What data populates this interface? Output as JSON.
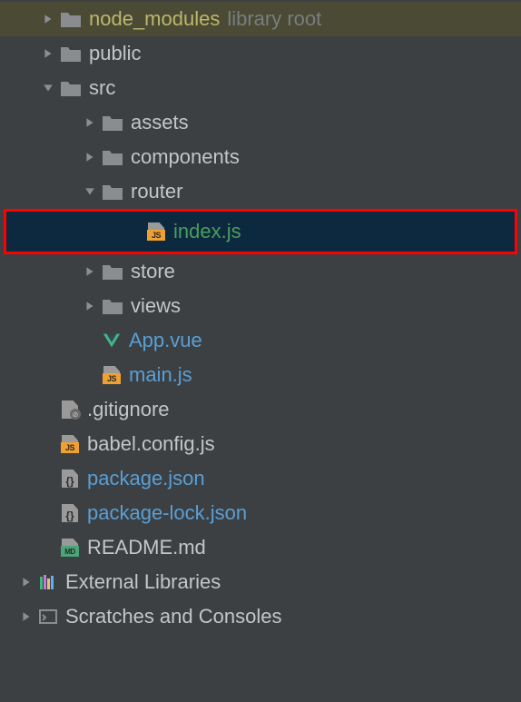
{
  "tree": {
    "node_modules": {
      "label": "node_modules",
      "hint": "library root"
    },
    "public": {
      "label": "public"
    },
    "src": {
      "label": "src"
    },
    "assets": {
      "label": "assets"
    },
    "components": {
      "label": "components"
    },
    "router": {
      "label": "router"
    },
    "index_js": {
      "label": "index.js"
    },
    "store": {
      "label": "store"
    },
    "views": {
      "label": "views"
    },
    "app_vue": {
      "label": "App.vue"
    },
    "main_js": {
      "label": "main.js"
    },
    "gitignore": {
      "label": ".gitignore"
    },
    "babel_config": {
      "label": "babel.config.js"
    },
    "package_json": {
      "label": "package.json"
    },
    "package_lock": {
      "label": "package-lock.json"
    },
    "readme": {
      "label": "README.md"
    },
    "external_libs": {
      "label": "External Libraries"
    },
    "scratches": {
      "label": "Scratches and Consoles"
    }
  }
}
